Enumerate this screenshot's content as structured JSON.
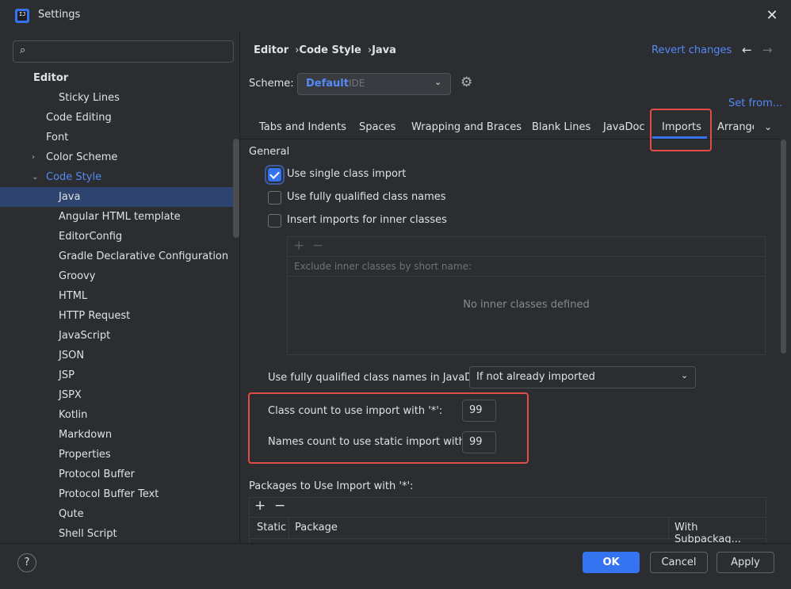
{
  "window": {
    "title": "Settings"
  },
  "search": {
    "placeholder": ""
  },
  "tree": [
    {
      "label": "Editor",
      "bold": true,
      "chevron": ""
    },
    {
      "label": "Sticky Lines",
      "chevron": ""
    },
    {
      "label": "Code Editing",
      "chevron": ""
    },
    {
      "label": "Font",
      "chevron": ""
    },
    {
      "label": "Color Scheme",
      "chevron": "›"
    },
    {
      "label": "Code Style",
      "chevron": "⌄",
      "accent": true
    },
    {
      "label": "Java",
      "selected": true,
      "chevron": ""
    },
    {
      "label": "Angular HTML template",
      "chevron": ""
    },
    {
      "label": "EditorConfig",
      "chevron": ""
    },
    {
      "label": "Gradle Declarative Configuration",
      "chevron": ""
    },
    {
      "label": "Groovy",
      "chevron": ""
    },
    {
      "label": "HTML",
      "chevron": ""
    },
    {
      "label": "HTTP Request",
      "chevron": ""
    },
    {
      "label": "JavaScript",
      "chevron": ""
    },
    {
      "label": "JSON",
      "chevron": ""
    },
    {
      "label": "JSP",
      "chevron": ""
    },
    {
      "label": "JSPX",
      "chevron": ""
    },
    {
      "label": "Kotlin",
      "chevron": ""
    },
    {
      "label": "Markdown",
      "chevron": ""
    },
    {
      "label": "Properties",
      "chevron": ""
    },
    {
      "label": "Protocol Buffer",
      "chevron": ""
    },
    {
      "label": "Protocol Buffer Text",
      "chevron": ""
    },
    {
      "label": "Qute",
      "chevron": ""
    },
    {
      "label": "Shell Script",
      "chevron": ""
    }
  ],
  "breadcrumb": [
    "Editor",
    "Code Style",
    "Java"
  ],
  "revert_label": "Revert changes",
  "scheme": {
    "label": "Scheme:",
    "name": "Default",
    "type": "IDE"
  },
  "set_from_label": "Set from...",
  "tabs": [
    "Tabs and Indents",
    "Spaces",
    "Wrapping and Braces",
    "Blank Lines",
    "JavaDoc",
    "Imports",
    "Arrange"
  ],
  "active_tab": "Imports",
  "general": {
    "title": "General",
    "options": [
      {
        "label": "Use single class import",
        "checked": true
      },
      {
        "label": "Use fully qualified class names",
        "checked": false
      },
      {
        "label": "Insert imports for inner classes",
        "checked": false
      }
    ],
    "inner_table_header": "Exclude inner classes by short name:",
    "inner_table_empty": "No inner classes defined"
  },
  "javadoc": {
    "label": "Use fully qualified class names in JavaDoc:",
    "value": "If not already imported"
  },
  "class_count": {
    "label": "Class count to use import with '*':",
    "value": "99"
  },
  "names_count": {
    "label": "Names count to use static import with '*':",
    "value": "99"
  },
  "packages": {
    "title": "Packages to Use Import with '*':",
    "columns": [
      "Static",
      "Package",
      "With Subpackag..."
    ]
  },
  "footer": {
    "help": "?",
    "ok": "OK",
    "cancel": "Cancel",
    "apply": "Apply"
  },
  "colors": {
    "accent": "#3574f0",
    "link": "#548af7",
    "highlight_box": "#e34b48",
    "selection": "#2e436e"
  }
}
